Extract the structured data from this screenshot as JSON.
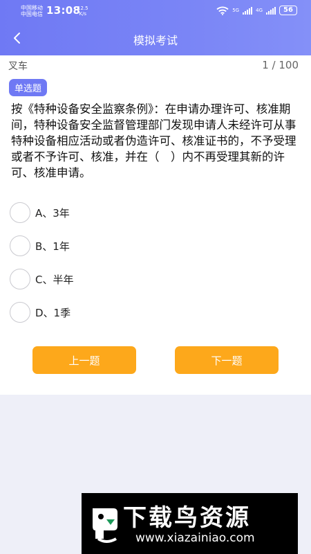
{
  "status": {
    "carrier1": "中国移动",
    "carrier2": "中国电信",
    "time": "13:08",
    "speed_value": "12.5",
    "speed_unit": "K/s",
    "net1": "5G",
    "net2": "4G",
    "battery": "56"
  },
  "header": {
    "title": "模拟考试",
    "back_icon": "chevron-left-icon"
  },
  "question": {
    "category": "叉车",
    "progress": "1 / 100",
    "type_badge": "单选题",
    "text": "按《特种设备安全监察条例》：在申请办理许可、核准期间，特种设备安全监督管理部门发现申请人未经许可从事特种设备相应活动或者伪造许可、核准证书的，不予受理或者不予许可、核准，并在（　）内不再受理其新的许可、核准申请。",
    "options": [
      {
        "label": "A、3年"
      },
      {
        "label": "B、1年"
      },
      {
        "label": "C、半年"
      },
      {
        "label": "D、1季"
      }
    ]
  },
  "nav": {
    "prev_label": "上一题",
    "next_label": "下一题"
  },
  "watermark": {
    "title": "下载鸟资源",
    "url": "www.xiazainiao.com"
  },
  "colors": {
    "primary": "#6f79f4",
    "button": "#fda81b",
    "bottom_bg": "#eeeff8"
  }
}
